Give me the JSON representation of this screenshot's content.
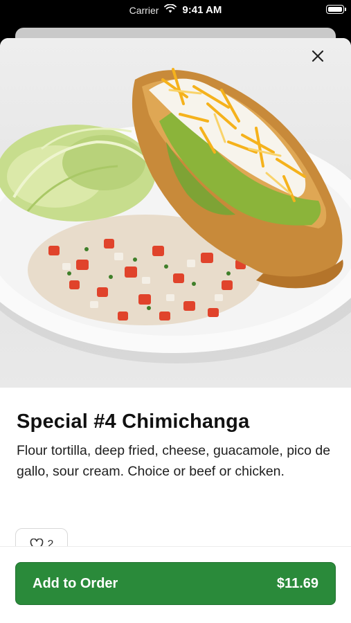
{
  "status_bar": {
    "carrier": "Carrier",
    "time": "9:41 AM",
    "icons": [
      "wifi-icon",
      "battery-icon"
    ]
  },
  "item": {
    "title": "Special #4 Chimichanga",
    "description": "Flour tortilla, deep fried, cheese, guacamole, pico de gallo, sour cream. Choice or beef or chicken.",
    "image_alt": "Chimichanga with guacamole, sour cream, cheese, shredded lettuce and pico de gallo"
  },
  "likes": {
    "count": "2",
    "icon": "heart-outline-icon"
  },
  "order": {
    "button_label": "Add to Order",
    "price": "$11.69"
  },
  "colors": {
    "accent": "#2a8a3a",
    "background": "#ffffff",
    "text": "#111111"
  }
}
